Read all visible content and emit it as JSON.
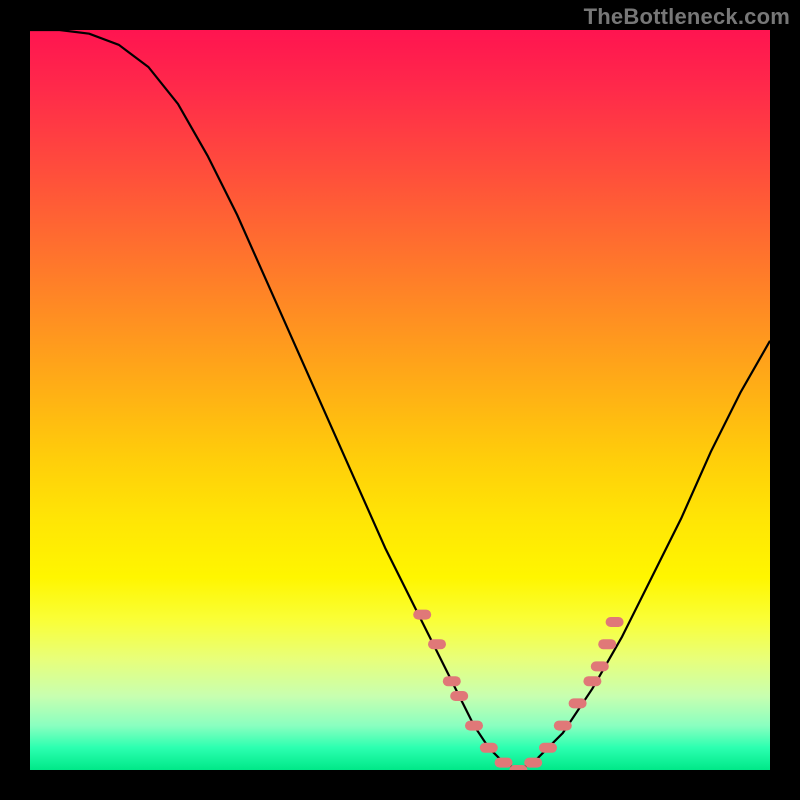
{
  "watermark": "TheBottleneck.com",
  "chart_data": {
    "type": "line",
    "title": "",
    "xlabel": "",
    "ylabel": "",
    "xlim": [
      0,
      100
    ],
    "ylim": [
      0,
      100
    ],
    "series": [
      {
        "name": "curve",
        "x": [
          0,
          4,
          8,
          12,
          16,
          20,
          24,
          28,
          32,
          36,
          40,
          44,
          48,
          52,
          56,
          58,
          60,
          62,
          64,
          66,
          68,
          72,
          76,
          80,
          84,
          88,
          92,
          96,
          100
        ],
        "values": [
          100,
          100,
          99.5,
          98,
          95,
          90,
          83,
          75,
          66,
          57,
          48,
          39,
          30,
          22,
          14,
          10,
          6,
          3,
          1,
          0,
          1,
          5,
          11,
          18,
          26,
          34,
          43,
          51,
          58
        ]
      }
    ],
    "markers": {
      "name": "highlight-points",
      "color": "#e07878",
      "x": [
        53,
        55,
        57,
        58,
        60,
        62,
        64,
        66,
        68,
        70,
        72,
        74,
        76,
        77,
        78,
        79
      ],
      "values": [
        21,
        17,
        12,
        10,
        6,
        3,
        1,
        0,
        1,
        3,
        6,
        9,
        12,
        14,
        17,
        20
      ]
    },
    "gradient_stops": [
      {
        "pct": 0,
        "color": "#ff1450"
      },
      {
        "pct": 18,
        "color": "#ff4a3d"
      },
      {
        "pct": 38,
        "color": "#ff8c23"
      },
      {
        "pct": 58,
        "color": "#ffce0a"
      },
      {
        "pct": 74,
        "color": "#fff600"
      },
      {
        "pct": 90,
        "color": "#c8ffb0"
      },
      {
        "pct": 100,
        "color": "#00e888"
      }
    ]
  }
}
